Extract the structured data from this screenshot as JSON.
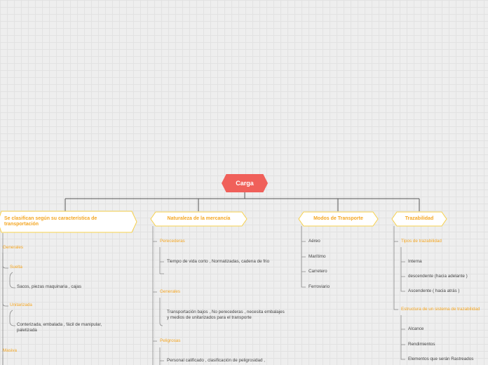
{
  "root": {
    "label": "Carga"
  },
  "branches": [
    {
      "label": "Se clasifican según su característica de transportación",
      "groups": [
        {
          "label": "Generales",
          "subgroups": [
            {
              "label": "Suelta",
              "items": [
                "Sacos, piezas  maquinaria , cajas"
              ]
            },
            {
              "label": "Unitarizada",
              "items": [
                "Conterizada, embalada , fácil de manipular, paletizada"
              ]
            }
          ]
        },
        {
          "label": "Masiva",
          "subgroups": []
        }
      ]
    },
    {
      "label": "Naturaleza de la mercancía",
      "groups": [
        {
          "label": "Perecederas",
          "items": [
            "Tiempo de vida corto , Normatizadas, cadena de frio",
            ""
          ]
        },
        {
          "label": "Generales",
          "items": [
            "Transportación bajos , No perecederas , necesita embalajes y medios de unitarizados para el transporte"
          ]
        },
        {
          "label": "Peligrosas",
          "items": [
            "Personal calificado , clasificación  de peligrosidad ,"
          ]
        }
      ]
    },
    {
      "label": "Modos de Transporte",
      "items": [
        "Aéreo",
        "Marítimo",
        "Carretero",
        "Ferroviario"
      ]
    },
    {
      "label": "Trazabilidad",
      "groups": [
        {
          "label": "Tipos de trazabilidad",
          "items": [
            "Interna",
            "descendente (hacia adelante )",
            "Ascendente ( hacia atrás )"
          ]
        },
        {
          "label": "Estructura de un sistema de trazabilidad",
          "items": [
            "Alcance",
            "Rendimientos",
            "Elementos que serán Rastreados"
          ]
        }
      ]
    }
  ]
}
